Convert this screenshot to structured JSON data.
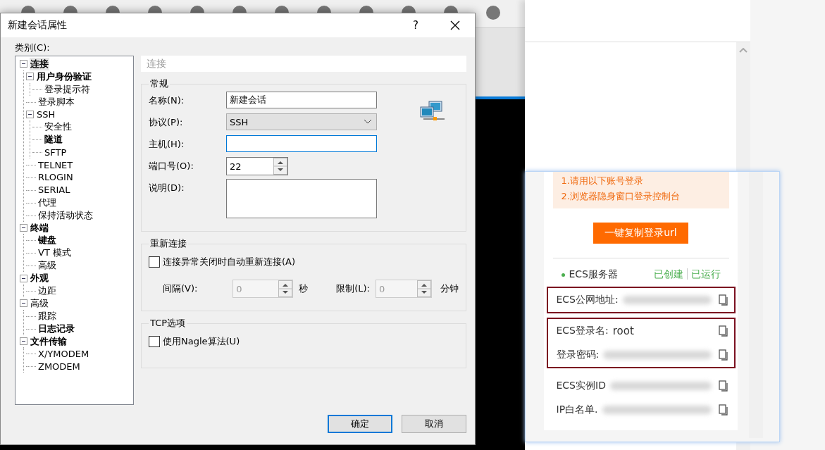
{
  "dialog": {
    "title": "新建会话属性",
    "help": "?",
    "category_label": "类别(C):",
    "tree": [
      {
        "label": "连接",
        "bold": true,
        "selected": true,
        "expanded": true,
        "children": [
          {
            "label": "用户身份验证",
            "bold": true,
            "selected": false,
            "expanded": true,
            "children": [
              {
                "label": "登录提示符",
                "bold": false,
                "selected": false
              }
            ]
          },
          {
            "label": "登录脚本",
            "bold": false,
            "selected": false
          },
          {
            "label": "SSH",
            "bold": false,
            "selected": false,
            "expanded": true,
            "children": [
              {
                "label": "安全性",
                "bold": false,
                "selected": false
              },
              {
                "label": "隧道",
                "bold": true,
                "selected": false
              },
              {
                "label": "SFTP",
                "bold": false,
                "selected": false
              }
            ]
          },
          {
            "label": "TELNET",
            "bold": false,
            "selected": false
          },
          {
            "label": "RLOGIN",
            "bold": false,
            "selected": false
          },
          {
            "label": "SERIAL",
            "bold": false,
            "selected": false
          },
          {
            "label": "代理",
            "bold": false,
            "selected": false
          },
          {
            "label": "保持活动状态",
            "bold": false,
            "selected": false
          }
        ]
      },
      {
        "label": "终端",
        "bold": true,
        "selected": false,
        "expanded": true,
        "children": [
          {
            "label": "键盘",
            "bold": true,
            "selected": false
          },
          {
            "label": "VT 模式",
            "bold": false,
            "selected": false
          },
          {
            "label": "高级",
            "bold": false,
            "selected": false
          }
        ]
      },
      {
        "label": "外观",
        "bold": true,
        "selected": false,
        "expanded": true,
        "children": [
          {
            "label": "边距",
            "bold": false,
            "selected": false
          }
        ]
      },
      {
        "label": "高级",
        "bold": false,
        "selected": false,
        "expanded": true,
        "children": [
          {
            "label": "跟踪",
            "bold": false,
            "selected": false
          },
          {
            "label": "日志记录",
            "bold": true,
            "selected": false
          }
        ]
      },
      {
        "label": "文件传输",
        "bold": true,
        "selected": false,
        "expanded": true,
        "children": [
          {
            "label": "X/YMODEM",
            "bold": false,
            "selected": false
          },
          {
            "label": "ZMODEM",
            "bold": false,
            "selected": false
          }
        ]
      }
    ],
    "page_header": "连接",
    "general": {
      "title": "常规",
      "fields": [
        {
          "kind": "text",
          "label": "名称(N):",
          "value": "新建会话",
          "focused": false
        },
        {
          "kind": "select",
          "label": "协议(P):",
          "value": "SSH"
        },
        {
          "kind": "text",
          "label": "主机(H):",
          "focused": true
        },
        {
          "kind": "spin",
          "label": "端口号(O):",
          "value": "22"
        },
        {
          "kind": "textarea",
          "label": "说明(D):"
        }
      ]
    },
    "reconnect": {
      "title": "重新连接",
      "checkbox": {
        "label": "连接异常关闭时自动重新连接(A)",
        "checked": false
      },
      "interval": {
        "label": "间隔(V):",
        "value": "0",
        "unit": "秒",
        "disabled": true
      },
      "limit": {
        "label": "限制(L):",
        "value": "0",
        "unit": "分钟",
        "disabled": true
      }
    },
    "tcp": {
      "title": "TCP选项",
      "checkbox": {
        "label": "使用Nagle算法(U)",
        "checked": false
      }
    },
    "buttons": [
      {
        "label": "确定",
        "default": true
      },
      {
        "label": "取消",
        "default": false
      }
    ]
  },
  "popup": {
    "notes": [
      "1.请用以下账号登录",
      "2.浏览器隐身窗口登录控制台"
    ],
    "copy_button": "一键复制登录url",
    "server": {
      "label": "ECS服务器",
      "status": [
        "已创建",
        "已运行"
      ]
    },
    "groups": [
      {
        "highlighted": true,
        "rows": [
          {
            "label": "ECS公网地址:",
            "masked": true
          }
        ]
      },
      {
        "highlighted": true,
        "rows": [
          {
            "label": "ECS登录名:",
            "value": "root",
            "masked": false
          },
          {
            "label": "登录密码:",
            "masked": true
          }
        ]
      },
      {
        "highlighted": false,
        "rows": [
          {
            "label": "ECS实例ID",
            "masked": true
          },
          {
            "label": "IP白名单.",
            "masked": true
          }
        ]
      }
    ]
  }
}
